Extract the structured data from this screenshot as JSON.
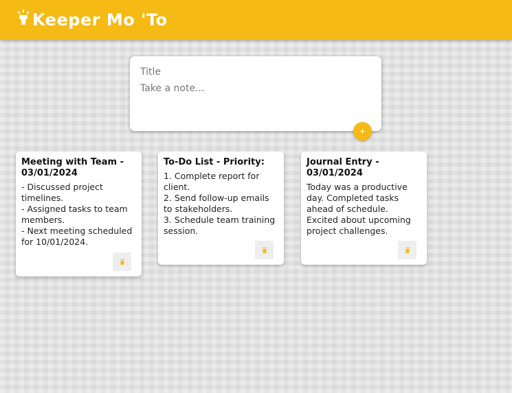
{
  "header": {
    "title": "Keeper Mo 'To",
    "logo_icon": "lightbulb-icon",
    "color": "#f5ba13"
  },
  "create_note": {
    "title_placeholder": "Title",
    "content_placeholder": "Take a note...",
    "add_label": "+",
    "add_icon": "plus-icon"
  },
  "notes": [
    {
      "title": "Meeting with Team - 03/01/2024",
      "content": "- Discussed project timelines.\n- Assigned tasks to team members.\n- Next meeting scheduled for 10/01/2024.",
      "delete_icon": "trash-icon"
    },
    {
      "title": "To-Do List - Priority:",
      "content": "1. Complete report for client.\n2. Send follow-up emails to stakeholders.\n3. Schedule team training session.",
      "delete_icon": "trash-icon"
    },
    {
      "title": "Journal Entry - 03/01/2024",
      "content": "Today was a productive day. Completed tasks ahead of schedule. Excited about upcoming project challenges.",
      "delete_icon": "trash-icon"
    }
  ]
}
